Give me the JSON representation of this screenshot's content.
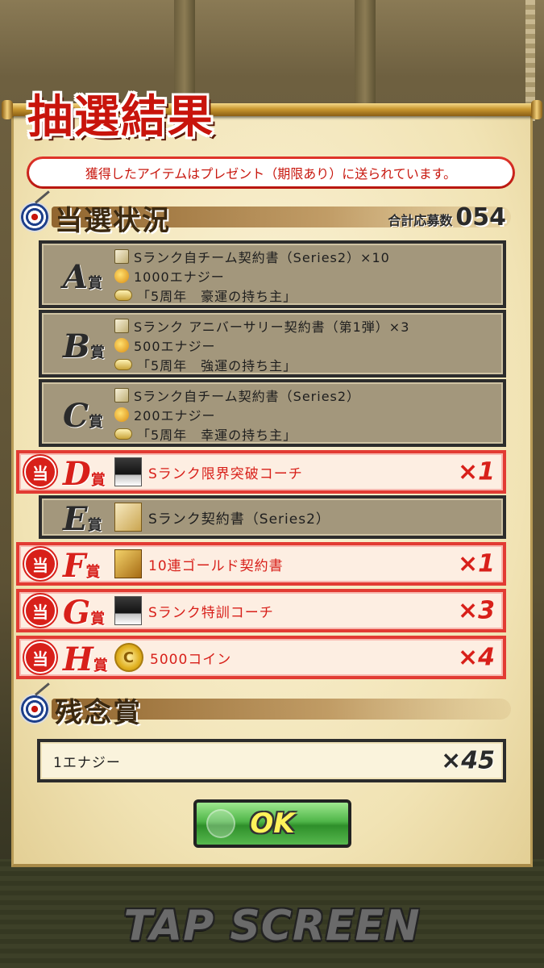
{
  "title": "抽選結果",
  "notice": "獲得したアイテムはプレゼント（期限あり）に送られています。",
  "results": {
    "heading": "当選状況",
    "applicants_label": "合計応募数",
    "applicants_count": "054",
    "win_mark": "当",
    "prizes": [
      {
        "rank": "A",
        "suffix": "賞",
        "won": false,
        "items": [
          "Sランク自チーム契約書（Series2）×10",
          "1000エナジー",
          "「5周年　豪運の持ち主」"
        ]
      },
      {
        "rank": "B",
        "suffix": "賞",
        "won": false,
        "items": [
          "Sランク アニバーサリー契約書（第1弾）×3",
          "500エナジー",
          "「5周年　強運の持ち主」"
        ]
      },
      {
        "rank": "C",
        "suffix": "賞",
        "won": false,
        "items": [
          "Sランク自チーム契約書（Series2）",
          "200エナジー",
          "「5周年　幸運の持ち主」"
        ]
      },
      {
        "rank": "D",
        "suffix": "賞",
        "won": true,
        "item": "Sランク限界突破コーチ",
        "multiplier": "×1"
      },
      {
        "rank": "E",
        "suffix": "賞",
        "won": false,
        "item": "Sランク契約書（Series2）"
      },
      {
        "rank": "F",
        "suffix": "賞",
        "won": true,
        "item": "10連ゴールド契約書",
        "multiplier": "×1"
      },
      {
        "rank": "G",
        "suffix": "賞",
        "won": true,
        "item": "Sランク特訓コーチ",
        "multiplier": "×3"
      },
      {
        "rank": "H",
        "suffix": "賞",
        "won": true,
        "item": "5000コイン",
        "multiplier": "×4"
      }
    ]
  },
  "consolation": {
    "heading": "残念賞",
    "item": "1エナジー",
    "multiplier": "×45"
  },
  "ok_label": "OK",
  "tap_screen": "TAP SCREEN",
  "colors": {
    "accent_red": "#d8201a",
    "button_green": "#4fb548",
    "paper": "#f1e3b4"
  }
}
